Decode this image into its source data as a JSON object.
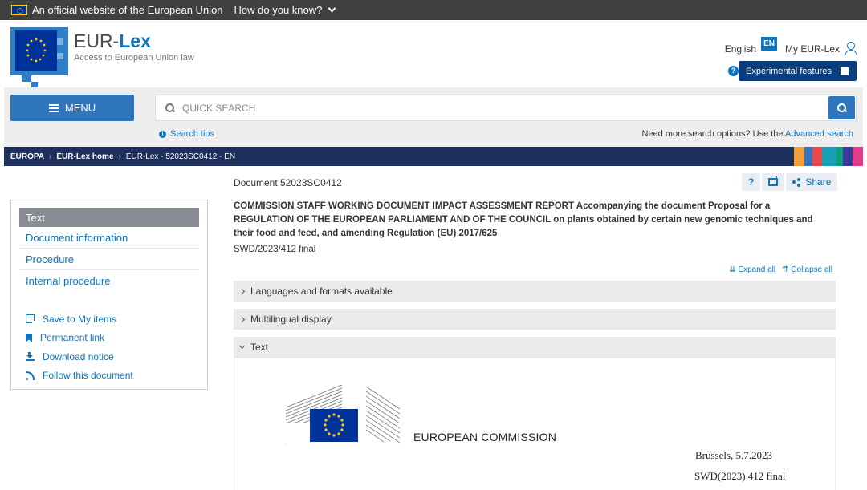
{
  "eu_banner": {
    "official_text": "An official website of the European Union",
    "how_text": "How do you know?"
  },
  "header": {
    "logo_title_prefix": "EUR-",
    "logo_title_bold": "Lex",
    "logo_subtitle": "Access to European Union law",
    "language_label": "English",
    "language_code": "EN",
    "my_eurlex_label": "My EUR-Lex",
    "experimental_help": "?",
    "experimental_label": "Experimental features"
  },
  "search": {
    "menu_label": "MENU",
    "placeholder": "QUICK SEARCH",
    "tips_label": "Search tips",
    "more_options_text": "Need more search options? Use the",
    "advanced_link": "Advanced search"
  },
  "breadcrumb": {
    "items": [
      "EUROPA",
      "EUR-Lex home",
      "EUR-Lex - 52023SC0412 - EN"
    ],
    "stripe_colors": [
      "#f2a13a",
      "#3a73b9",
      "#e84a4a",
      "#19a0b8",
      "#0f9e7b",
      "#3a3a9c",
      "#e23d8c"
    ]
  },
  "sidebar": {
    "nav": [
      "Text",
      "Document information",
      "Procedure",
      "Internal procedure"
    ],
    "actions": [
      {
        "label": "Save to My items",
        "icon": "save-icon"
      },
      {
        "label": "Permanent link",
        "icon": "bookmark-icon"
      },
      {
        "label": "Download notice",
        "icon": "download-icon"
      },
      {
        "label": "Follow this document",
        "icon": "rss-icon"
      }
    ]
  },
  "document": {
    "id_line": "Document 52023SC0412",
    "help_label": "?",
    "share_label": "Share",
    "title": "COMMISSION STAFF WORKING DOCUMENT IMPACT ASSESSMENT REPORT Accompanying the document Proposal for a REGULATION OF THE EUROPEAN PARLIAMENT AND OF THE COUNCIL on plants obtained by certain new genomic techniques and their food and feed, and amending Regulation (EU) 2017/625",
    "reference": "SWD/2023/412 final",
    "expand_all": "Expand all",
    "collapse_all": "Collapse all",
    "sections": [
      "Languages and formats available",
      "Multilingual display",
      "Text"
    ],
    "body_org": "EUROPEAN COMMISSION",
    "body_place_date": "Brussels, 5.7.2023",
    "body_ref": "SWD(2023) 412 final"
  },
  "colors": {
    "accent": "#0e74bb",
    "menu_button": "#2f76bd",
    "breadcrumb_bg": "#1d2f5c",
    "experimental_bg": "#0a3d7c",
    "sidebar_active": "#888c95"
  }
}
